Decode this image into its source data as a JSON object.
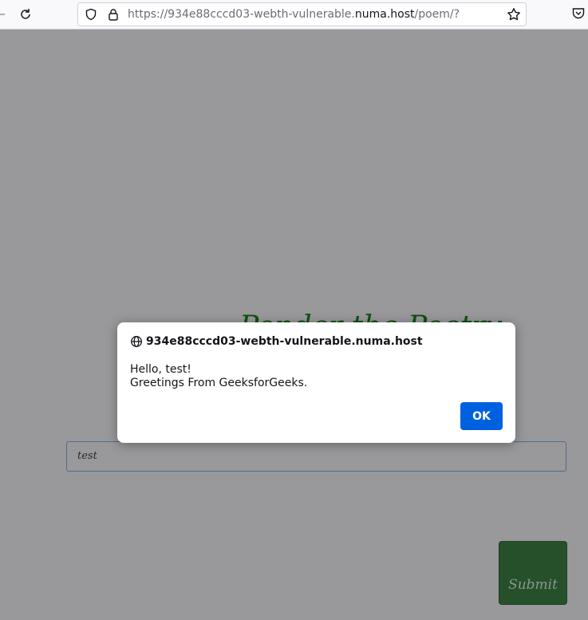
{
  "browser": {
    "url_prefix": "https://934e88cccd03-webth-vulnerable.",
    "url_domain": "numa.host",
    "url_path": "/poem/?"
  },
  "page": {
    "heading": "Ponder the Poetry",
    "input_value": "test",
    "submit_label": "Submit"
  },
  "dialog": {
    "host": "934e88cccd03-webth-vulnerable.numa.host",
    "line1": "Hello, test!",
    "line2": "Greetings From GeeksforGeeks.",
    "ok_label": "OK"
  },
  "colors": {
    "heading_green": "#008000",
    "submit_green": "#2e7d32",
    "ok_blue": "#0061e0"
  }
}
